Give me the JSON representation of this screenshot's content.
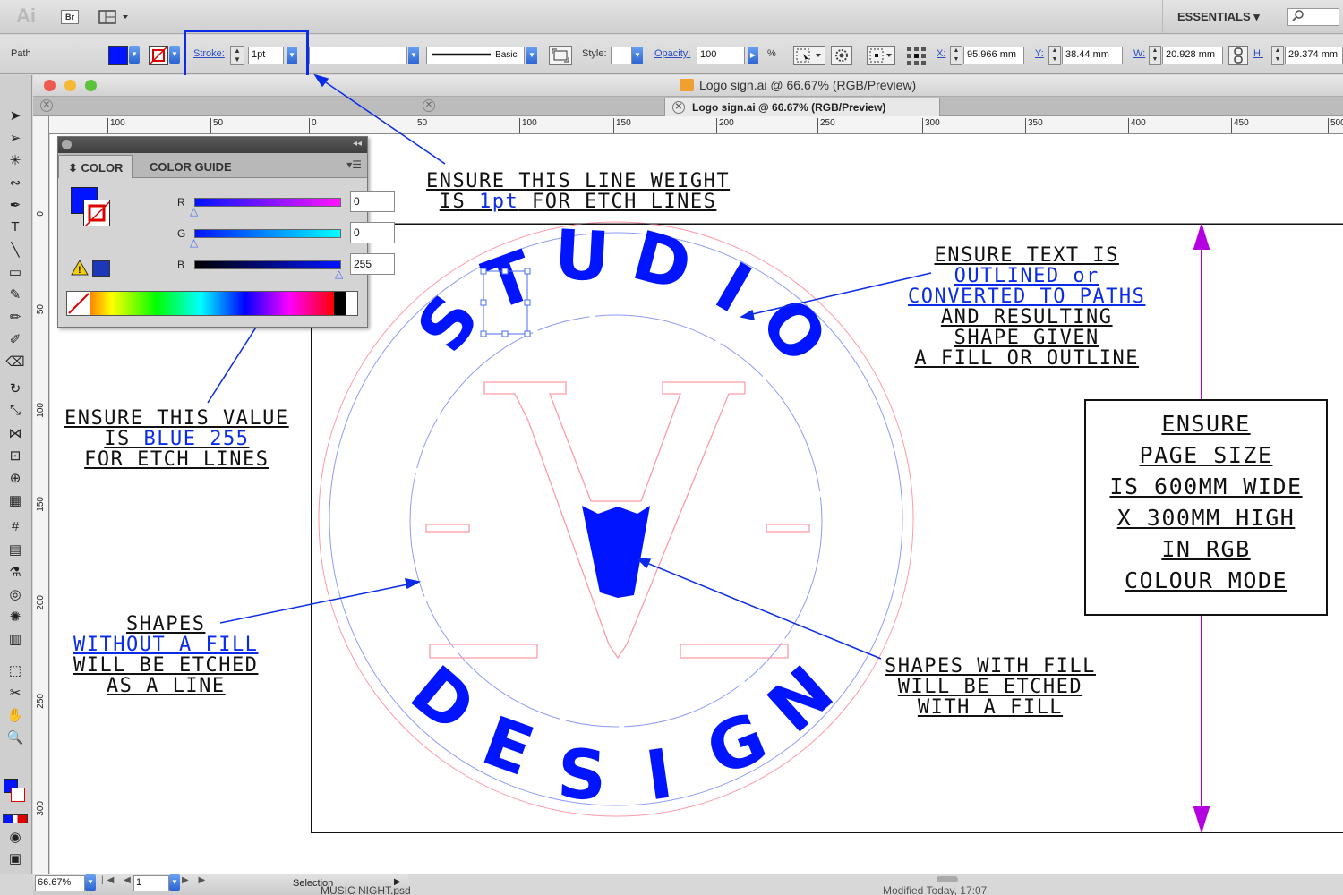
{
  "app": {
    "logo": "Ai",
    "bridge": "Br",
    "workspace": "ESSENTIALS ▾",
    "search_icon": "search-icon"
  },
  "control_bar": {
    "object_type": "Path",
    "stroke_label": "Stroke:",
    "stroke_value": "1pt",
    "brush_label": "Basic",
    "style_label": "Style:",
    "opacity_label": "Opacity:",
    "opacity_value": "100",
    "opacity_unit": "%",
    "x_label": "X:",
    "x_value": "95.966 mm",
    "y_label": "Y:",
    "y_value": "38.44 mm",
    "w_label": "W:",
    "w_value": "20.928 mm",
    "h_label": "H:",
    "h_value": "29.374 mm",
    "fill_color": "#0014ff"
  },
  "document": {
    "title": "Logo sign.ai @ 66.67% (RGB/Preview)",
    "tab_title": "Logo sign.ai @ 66.67% (RGB/Preview)"
  },
  "ruler": {
    "h_ticks": [
      "100",
      "50",
      "0",
      "50",
      "100",
      "150",
      "200",
      "250",
      "300",
      "350",
      "400",
      "450",
      "500"
    ],
    "v_ticks": [
      "0",
      "5 0",
      "1 0 0",
      "1 5 0",
      "2 0 0",
      "2 5 0",
      "3 0 0"
    ]
  },
  "color_panel": {
    "tab_color": "⬍ COLOR",
    "tab_guide": "COLOR GUIDE",
    "r_label": "R",
    "g_label": "G",
    "b_label": "B",
    "r_value": "0",
    "g_value": "0",
    "b_value": "255"
  },
  "annotations": {
    "line_weight": [
      "ENSURE THIS LINE WEIGHT",
      "IS ",
      "1pt",
      " FOR ETCH LINES"
    ],
    "blue_value": [
      "ENSURE THIS VALUE",
      "IS ",
      "BLUE 255",
      "FOR ETCH LINES"
    ],
    "text_outline": [
      "ENSURE TEXT IS",
      "OUTLINED or",
      "CONVERTED TO PATHS",
      "AND RESULTING",
      "SHAPE GIVEN",
      "A FILL OR OUTLINE"
    ],
    "page_size": [
      "ENSURE",
      "PAGE SIZE",
      "IS 600MM WIDE",
      "X 300MM HIGH",
      "IN RGB",
      "COLOUR MODE"
    ],
    "no_fill": [
      "SHAPES",
      "WITHOUT A FILL",
      "WILL BE ETCHED",
      "AS A LINE"
    ],
    "with_fill": [
      "SHAPES WITH FILL",
      "WILL BE ETCHED",
      "WITH A FILL"
    ]
  },
  "logo_art": {
    "top_letters": [
      "S",
      "T",
      "U",
      "D",
      "I",
      "O"
    ],
    "bottom_letters": [
      "D",
      "E",
      "S",
      "I",
      "G",
      "N"
    ],
    "etch_color": "#0014ff",
    "guide_color": "#ff9aa8"
  },
  "status": {
    "zoom": "66.67%",
    "artboard": "1",
    "tool": "Selection",
    "behind_file": "MUSIC NIGHT.psd",
    "modified": "Modified   Today, 17:07"
  }
}
